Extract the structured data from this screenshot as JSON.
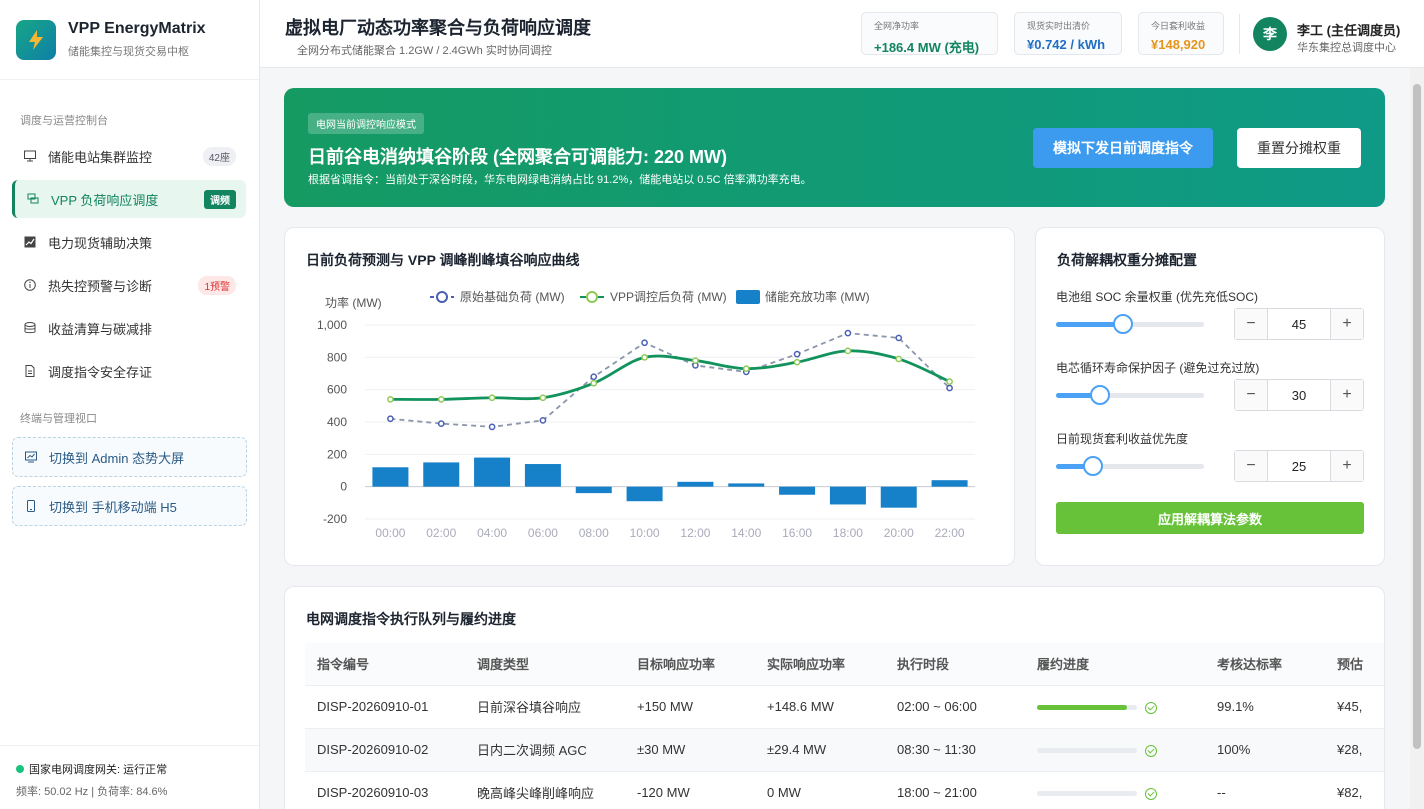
{
  "brand": {
    "title": "VPP EnergyMatrix",
    "subtitle": "储能集控与现货交易中枢"
  },
  "nav": {
    "section1": "调度与运营控制台",
    "section2": "终端与管理视口",
    "items": [
      {
        "label": "储能电站集群监控",
        "badge": "42座"
      },
      {
        "label": "VPP 负荷响应调度",
        "badge": "调频"
      },
      {
        "label": "电力现货辅助决策",
        "badge": ""
      },
      {
        "label": "热失控预警与诊断",
        "badge": "1预警"
      },
      {
        "label": "收益清算与碳减排",
        "badge": ""
      },
      {
        "label": "调度指令安全存证",
        "badge": ""
      }
    ],
    "terminals": [
      {
        "label": "切换到 Admin 态势大屏"
      },
      {
        "label": "切换到 手机移动端 H5"
      }
    ]
  },
  "status": {
    "line1": "国家电网调度网关: 运行正常",
    "line2": "频率: 50.02 Hz | 负荷率: 84.6%"
  },
  "header": {
    "title": "虚拟电厂动态功率聚合与负荷响应调度",
    "subtitle": "全网分布式储能聚合 1.2GW / 2.4GWh 实时协同调控",
    "kpis": [
      {
        "label": "全网净功率",
        "value": "+186.4 MW (充电)",
        "color": "#12845f"
      },
      {
        "label": "现货实时出清价",
        "value": "¥0.742 / kWh",
        "color": "#1f6fc5"
      },
      {
        "label": "今日套利收益",
        "value": "¥148,920",
        "color": "#e6941a"
      }
    ],
    "user": {
      "initial": "李",
      "name": "李工 (主任调度员)",
      "role": "华东集控总调度中心"
    }
  },
  "banner": {
    "tag": "电网当前调控响应模式",
    "title": "日前谷电消纳填谷阶段 (全网聚合可调能力: 220 MW)",
    "desc": "根据省调指令：当前处于深谷时段，华东电网绿电消纳占比 91.2%，储能电站以 0.5C 倍率满功率充电。",
    "btn_primary": "模拟下发日前调度指令",
    "btn_secondary": "重置分摊权重"
  },
  "chart_card": {
    "title": "日前负荷预测与 VPP 调峰削峰填谷响应曲线"
  },
  "chart_data": {
    "type": "line",
    "ylabel": "功率 (MW)",
    "ylim": [
      -200,
      1000
    ],
    "yticks": [
      -200,
      0,
      200,
      400,
      600,
      800,
      1000
    ],
    "ytick_labels": [
      "-200",
      "0",
      "200",
      "400",
      "600",
      "800",
      "1,000"
    ],
    "categories": [
      "00:00",
      "02:00",
      "04:00",
      "06:00",
      "08:00",
      "10:00",
      "12:00",
      "14:00",
      "16:00",
      "18:00",
      "20:00",
      "22:00"
    ],
    "series": [
      {
        "name": "原始基础负荷 (MW)",
        "kind": "line-dashed",
        "color": "#8b95ab",
        "marker": "#4a5fb5",
        "values": [
          420,
          390,
          370,
          410,
          680,
          890,
          750,
          710,
          820,
          950,
          920,
          610
        ]
      },
      {
        "name": "VPP调控后负荷 (MW)",
        "kind": "line",
        "color": "#12935e",
        "marker": "#8fca55",
        "values": [
          540,
          540,
          550,
          550,
          640,
          800,
          780,
          730,
          770,
          840,
          790,
          650
        ]
      },
      {
        "name": "储能充放功率 (MW)",
        "kind": "bar",
        "color": "#1680c9",
        "values": [
          120,
          150,
          180,
          140,
          -40,
          -90,
          30,
          20,
          -50,
          -110,
          -130,
          40
        ]
      }
    ],
    "legend": "top"
  },
  "weights": {
    "title": "负荷解耦权重分摊配置",
    "apply": "应用解耦算法参数",
    "params": [
      {
        "label": "电池组 SOC 余量权重 (优先充低SOC)",
        "value": "45",
        "level": 0.45
      },
      {
        "label": "电芯循环寿命保护因子 (避免过充过放)",
        "value": "30",
        "level": 0.3
      },
      {
        "label": "日前现货套利收益优先度",
        "value": "25",
        "level": 0.25
      }
    ]
  },
  "queue": {
    "title": "电网调度指令执行队列与履约进度",
    "headers": [
      "指令编号",
      "调度类型",
      "目标响应功率",
      "实际响应功率",
      "执行时段",
      "履约进度",
      "考核达标率",
      "预估"
    ],
    "rows": [
      {
        "id": "DISP-20260910-01",
        "type": "日前深谷填谷响应",
        "target": "+150 MW",
        "actual": "+148.6 MW",
        "period": "02:00 ~ 06:00",
        "progress": 0.9,
        "rate": "99.1%",
        "est": "¥45,"
      },
      {
        "id": "DISP-20260910-02",
        "type": "日内二次调频 AGC",
        "target": "±30 MW",
        "actual": "±29.4 MW",
        "period": "08:30 ~ 11:30",
        "progress": 0,
        "rate": "100%",
        "est": "¥28,"
      },
      {
        "id": "DISP-20260910-03",
        "type": "晚高峰尖峰削峰响应",
        "target": "-120 MW",
        "actual": "0 MW",
        "period": "18:00 ~ 21:00",
        "progress": 0,
        "rate": "--",
        "est": "¥82,"
      }
    ]
  }
}
